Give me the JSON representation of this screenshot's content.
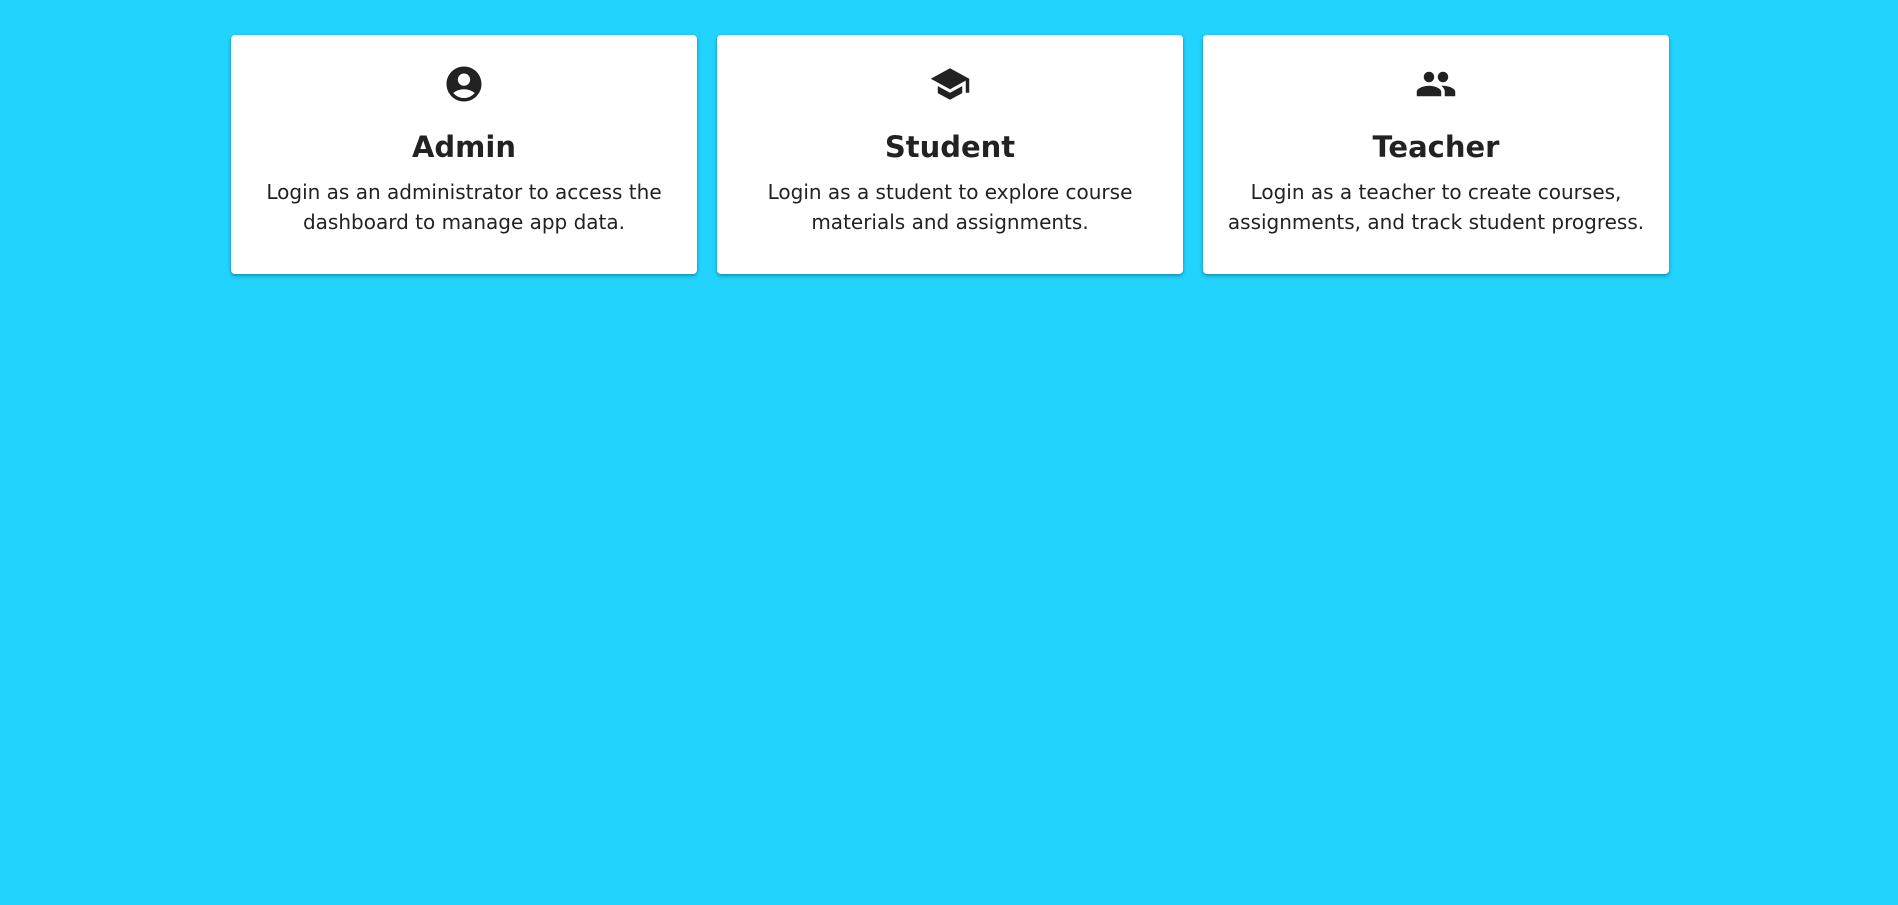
{
  "page": {
    "background_color": "#22d3fe"
  },
  "cards": [
    {
      "icon": "account-circle-icon",
      "title": "Admin",
      "description": "Login as an administrator to access the dashboard to manage app data."
    },
    {
      "icon": "graduation-cap-icon",
      "title": "Student",
      "description": "Login as a student to explore course materials and assignments."
    },
    {
      "icon": "people-icon",
      "title": "Teacher",
      "description": "Login as a teacher to create courses, assignments, and track student progress."
    }
  ]
}
